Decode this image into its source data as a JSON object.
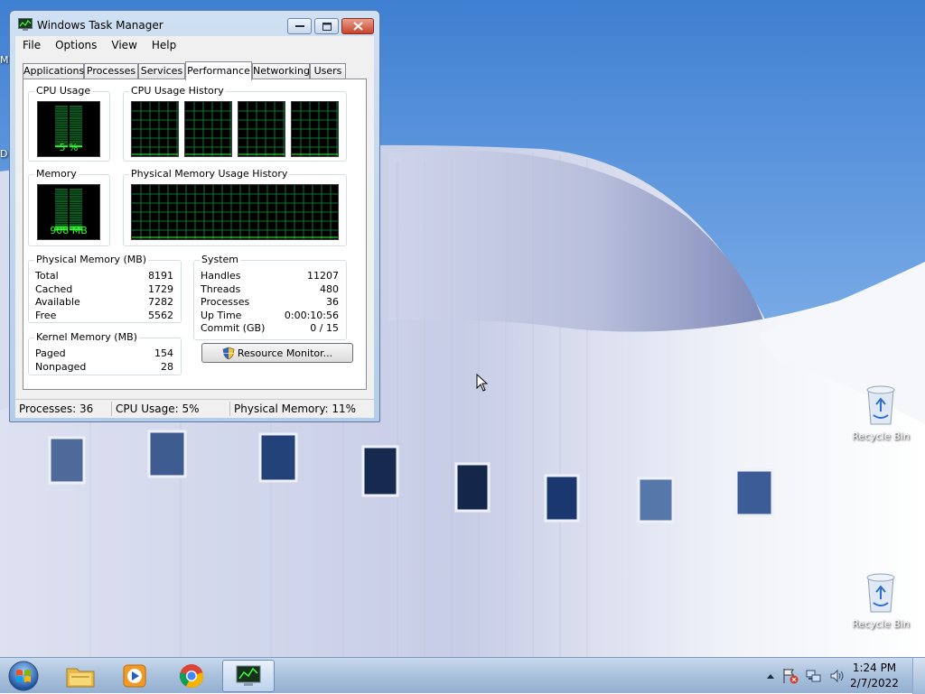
{
  "window": {
    "title": "Windows Task Manager",
    "menu": [
      "File",
      "Options",
      "View",
      "Help"
    ],
    "tabs": [
      "Applications",
      "Processes",
      "Services",
      "Performance",
      "Networking",
      "Users"
    ],
    "selected_tab": "Performance"
  },
  "performance": {
    "cpu_usage": {
      "label": "CPU Usage",
      "value_text": "5 %",
      "fraction": 0.05
    },
    "cpu_history": {
      "label": "CPU Usage History",
      "cores": 4
    },
    "memory": {
      "label": "Memory",
      "value_text": "908 MB",
      "fraction": 0.11
    },
    "memory_history": {
      "label": "Physical Memory Usage History"
    },
    "physical_memory": {
      "label": "Physical Memory (MB)",
      "rows": [
        {
          "label": "Total",
          "value": "8191"
        },
        {
          "label": "Cached",
          "value": "1729"
        },
        {
          "label": "Available",
          "value": "7282"
        },
        {
          "label": "Free",
          "value": "5562"
        }
      ]
    },
    "kernel_memory": {
      "label": "Kernel Memory (MB)",
      "rows": [
        {
          "label": "Paged",
          "value": "154"
        },
        {
          "label": "Nonpaged",
          "value": "28"
        }
      ]
    },
    "system": {
      "label": "System",
      "rows": [
        {
          "label": "Handles",
          "value": "11207"
        },
        {
          "label": "Threads",
          "value": "480"
        },
        {
          "label": "Processes",
          "value": "36"
        },
        {
          "label": "Up Time",
          "value": "0:00:10:56"
        },
        {
          "label": "Commit (GB)",
          "value": "0 / 15"
        }
      ]
    },
    "resource_monitor_label": "Resource Monitor..."
  },
  "status": {
    "processes": "Processes: 36",
    "cpu": "CPU Usage: 5%",
    "memory": "Physical Memory: 11%"
  },
  "desktop": {
    "icons": [
      {
        "label": "Recycle Bin"
      },
      {
        "label": "Recycle Bin"
      }
    ],
    "edge_letters": [
      "M",
      "D"
    ]
  },
  "taskbar": {
    "apps": [
      "explorer-icon",
      "media-player-icon",
      "chrome-icon",
      "task-manager-icon"
    ],
    "clock": {
      "time": "1:24 PM",
      "date": "2/7/2022"
    }
  },
  "colors": {
    "meter_green": "#2fff2f",
    "graph_grid": "#0b7a2f"
  }
}
